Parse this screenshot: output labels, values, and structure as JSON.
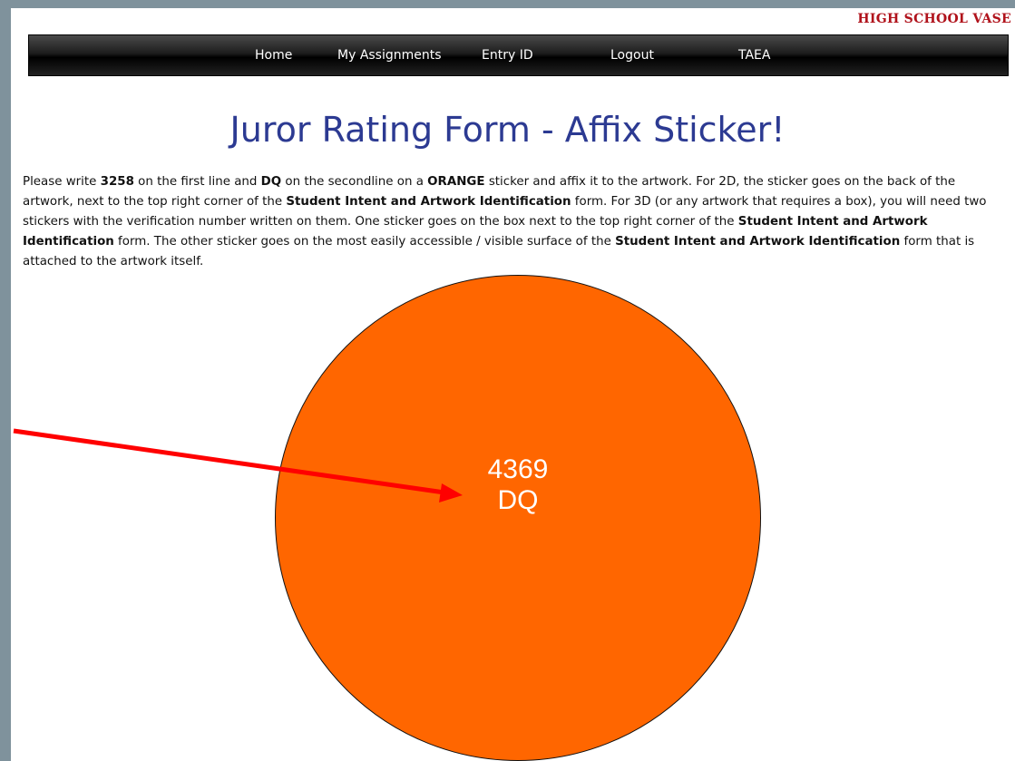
{
  "header": {
    "brand": "HIGH SCHOOL VASE"
  },
  "nav": {
    "items": [
      "Home",
      "My Assignments",
      "Entry ID",
      "Logout",
      "TAEA"
    ]
  },
  "main": {
    "title": "Juror Rating Form - Affix Sticker!",
    "instructions": {
      "t1": "Please write ",
      "b1": "3258",
      "t2": " on the first line and ",
      "b2": "DQ",
      "t3": " on the secondline on a ",
      "b3": "ORANGE",
      "t4": " sticker and affix it to the artwork. For 2D, the sticker goes on the back of the artwork, next to the top right corner of the ",
      "b4": "Student Intent and Artwork Identification",
      "t5": " form. For 3D (or any artwork that requires a box), you will need two stickers with the verification number written on them. One sticker goes on the box next to the top right corner of the ",
      "b5": "Student Intent and Artwork Identification",
      "t6": " form. The other sticker goes on the most easily accessible / visible surface of the ",
      "b6": "Student Intent and Artwork Identification",
      "t7": " form that is attached to the artwork itself."
    },
    "sticker": {
      "line1": "4369",
      "line2": "DQ",
      "color": "#ff6600"
    }
  },
  "colors": {
    "background": "#7f929c",
    "title": "#2c3a92",
    "brand": "#b0121b",
    "arrow": "#ff0000"
  },
  "annotation": {
    "icon": "red-arrow-icon"
  }
}
